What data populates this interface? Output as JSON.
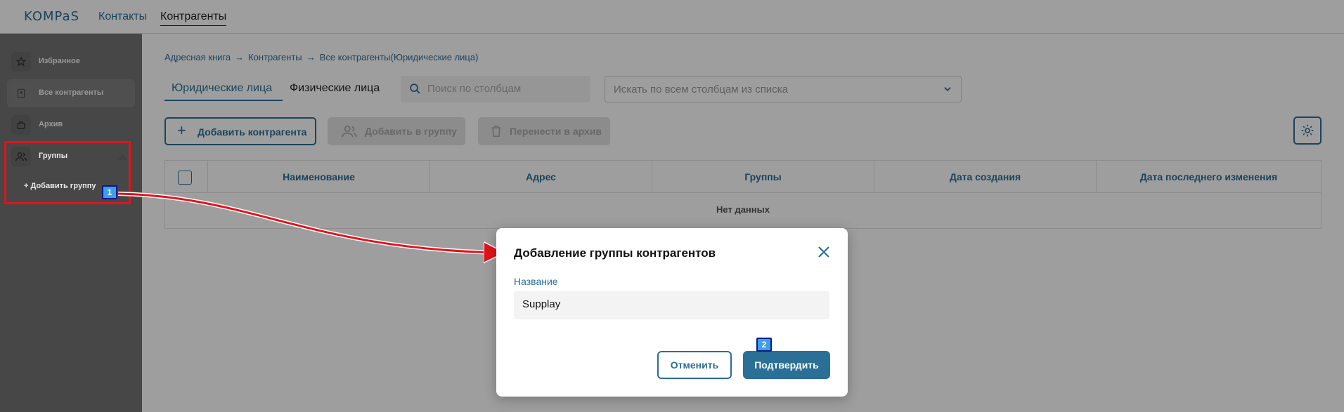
{
  "app": {
    "logo": "KOMPaS",
    "nav": [
      "Контакты",
      "Контрагенты"
    ]
  },
  "sidebar": {
    "items": [
      {
        "label": "Избранное",
        "icon": "star-icon"
      },
      {
        "label": "Все контрагенты",
        "icon": "contact-card-icon"
      },
      {
        "label": "Архив",
        "icon": "archive-icon"
      },
      {
        "label": "Группы",
        "icon": "users-icon"
      }
    ],
    "add_group": "+ Добавить группу"
  },
  "breadcrumb": [
    "Адресная книга",
    "Контрагенты",
    "Все контрагенты(Юридические лица)"
  ],
  "tabs": [
    "Юридические лица",
    "Физические лица"
  ],
  "search": {
    "columns_placeholder": "Поиск по столбцам",
    "all_placeholder": "Искать по всем столбцам из списка"
  },
  "toolbar": {
    "add": "Добавить контрагента",
    "add_to_group": "Добавить в группу",
    "archive": "Перенести в архив"
  },
  "table": {
    "columns": [
      "Наименование",
      "Адрес",
      "Группы",
      "Дата создания",
      "Дата последнего изменения"
    ],
    "empty": "Нет данных"
  },
  "modal": {
    "title": "Добавление группы контрагентов",
    "field_label": "Название",
    "field_value": "Supplay",
    "cancel": "Отменить",
    "confirm": "Подтвердить"
  },
  "annotations": {
    "badge1": "1",
    "badge2": "2"
  },
  "colors": {
    "accent": "#2a6f95",
    "annotation": "#e0141b"
  }
}
